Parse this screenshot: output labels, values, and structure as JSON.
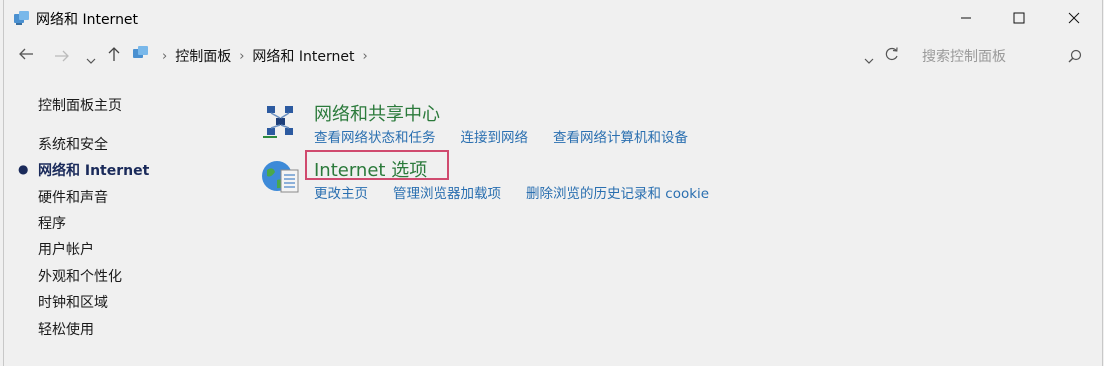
{
  "window": {
    "title": "网络和 Internet"
  },
  "breadcrumb": [
    "控制面板",
    "网络和 Internet"
  ],
  "search": {
    "placeholder": "搜索控制面板"
  },
  "sidebar": {
    "home": "控制面板主页",
    "items": [
      {
        "label": "系统和安全",
        "active": false
      },
      {
        "label": "网络和 Internet",
        "active": true
      },
      {
        "label": "硬件和声音",
        "active": false
      },
      {
        "label": "程序",
        "active": false
      },
      {
        "label": "用户帐户",
        "active": false
      },
      {
        "label": "外观和个性化",
        "active": false
      },
      {
        "label": "时钟和区域",
        "active": false
      },
      {
        "label": "轻松使用",
        "active": false
      }
    ]
  },
  "categories": [
    {
      "title": "网络和共享中心",
      "icon": "network-center-icon",
      "links": [
        "查看网络状态和任务",
        "连接到网络",
        "查看网络计算机和设备"
      ]
    },
    {
      "title": "Internet 选项",
      "icon": "internet-options-icon",
      "highlighted": true,
      "links": [
        "更改主页",
        "管理浏览器加载项",
        "删除浏览的历史记录和 cookie"
      ]
    }
  ],
  "colors": {
    "category_title": "#2b7a3b",
    "link": "#2a6fb0",
    "highlight_border": "#d04a6e"
  }
}
